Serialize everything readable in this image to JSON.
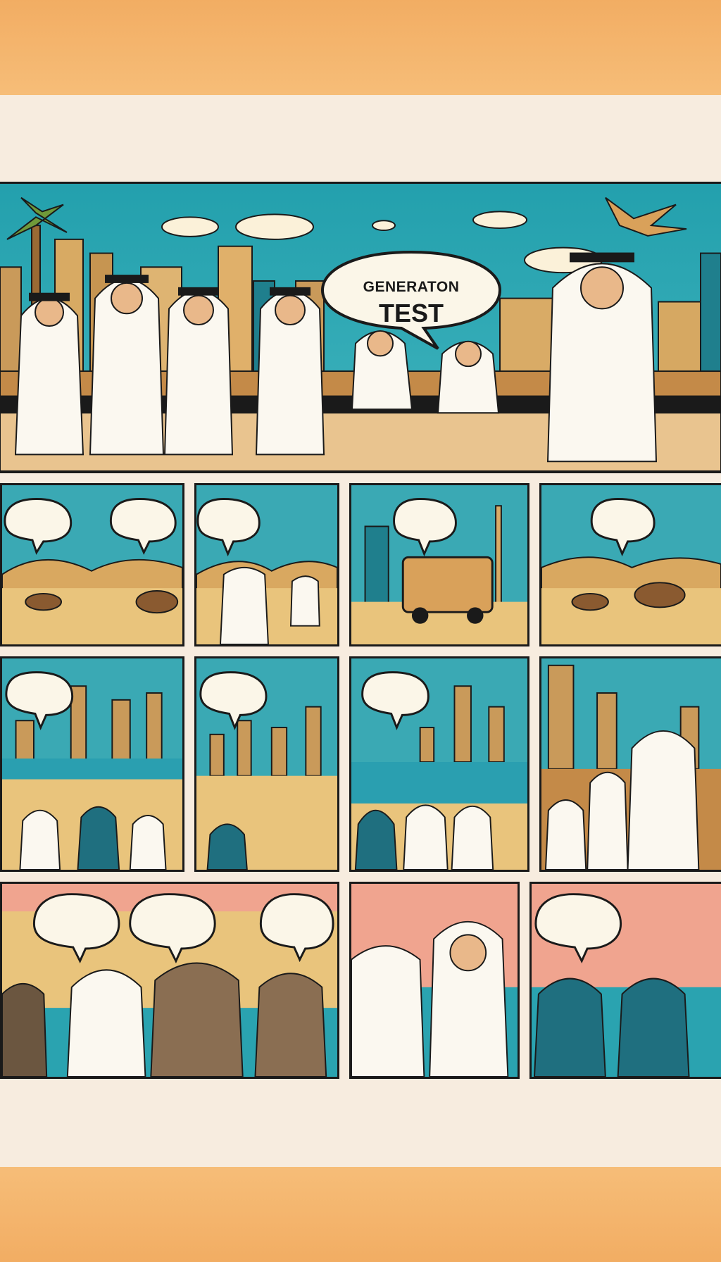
{
  "poster": {
    "speech_bubble": {
      "line1": "GENERATON",
      "line2": "TEST"
    }
  },
  "colors": {
    "band": "#f2ad63",
    "paper": "#f7ecdf",
    "sky": "#2aa3b0",
    "sand": "#e8c47a",
    "outline": "#1a1a1a",
    "bubble": "#fbf6e8"
  },
  "panels": {
    "row1": 1,
    "row2": 4,
    "row3": 4,
    "row4": 3
  }
}
